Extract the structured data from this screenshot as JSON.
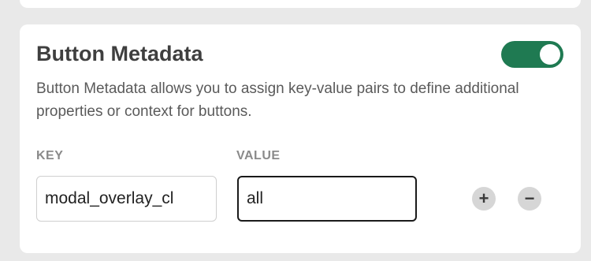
{
  "section": {
    "title": "Button Metadata",
    "description": "Button Metadata allows you to assign key-value pairs to define additional properties or context for buttons.",
    "toggle": {
      "state": "on",
      "color": "#1f7a52"
    }
  },
  "metadata": {
    "key_label": "KEY",
    "value_label": "VALUE",
    "rows": [
      {
        "key": "modal_overlay_cl",
        "value": "all"
      }
    ]
  },
  "icons": {
    "add": "plus-icon",
    "remove": "minus-icon"
  }
}
